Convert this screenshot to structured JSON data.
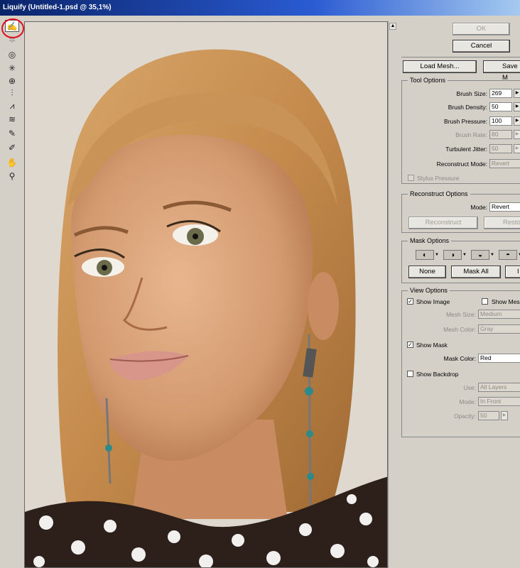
{
  "window": {
    "title": "Liquify (Untitled-1.psd @ 35,1%)"
  },
  "tools": [
    {
      "name": "forward-warp-tool",
      "icon": "finger-icon",
      "glyph": "✍",
      "active": true
    },
    {
      "name": "turbulence-tool",
      "icon": "turbulence-icon",
      "glyph": "✲",
      "dim": true
    },
    {
      "name": "twirl-tool",
      "icon": "twirl-icon",
      "glyph": "◎"
    },
    {
      "name": "pucker-tool",
      "icon": "pucker-icon",
      "glyph": "✳"
    },
    {
      "name": "bloat-tool",
      "icon": "bloat-icon",
      "glyph": "⊕"
    },
    {
      "name": "push-left-tool",
      "icon": "push-left-icon",
      "glyph": "⫶"
    },
    {
      "name": "mirror-tool",
      "icon": "mirror-icon",
      "glyph": "⩘"
    },
    {
      "name": "turbulence-wave-tool",
      "icon": "wave-icon",
      "glyph": "≋"
    },
    {
      "name": "freeze-mask-tool",
      "icon": "freeze-brush-icon",
      "glyph": "✎"
    },
    {
      "name": "thaw-mask-tool",
      "icon": "thaw-brush-icon",
      "glyph": "✐"
    },
    {
      "name": "hand-tool",
      "icon": "hand-icon",
      "glyph": "✋"
    },
    {
      "name": "zoom-tool",
      "icon": "magnifier-icon",
      "glyph": "⚲"
    }
  ],
  "buttons": {
    "ok": "OK",
    "cancel": "Cancel",
    "load_mesh": "Load Mesh...",
    "save_mesh": "Save M"
  },
  "tool_options": {
    "title": "Tool Options",
    "brush_size": {
      "label": "Brush Size:",
      "value": "269"
    },
    "brush_density": {
      "label": "Brush Density:",
      "value": "50"
    },
    "brush_pressure": {
      "label": "Brush Pressure:",
      "value": "100"
    },
    "brush_rate": {
      "label": "Brush Rate:",
      "value": "80"
    },
    "turbulent_jitter": {
      "label": "Turbulent Jitter:",
      "value": "50"
    },
    "reconstruct_mode": {
      "label": "Reconstruct Mode:",
      "value": "Revert"
    },
    "stylus_pressure": "Stylus Pressure"
  },
  "reconstruct_options": {
    "title": "Reconstruct Options",
    "mode_label": "Mode:",
    "mode_value": "Revert",
    "reconstruct_btn": "Reconstruct",
    "restore_btn": "Resto"
  },
  "mask_options": {
    "title": "Mask Options",
    "none_btn": "None",
    "mask_all_btn": "Mask All",
    "invert_btn": "I"
  },
  "view_options": {
    "title": "View Options",
    "show_image": "Show Image",
    "show_mesh": "Show Mes",
    "mesh_size": {
      "label": "Mesh Size:",
      "value": "Medium"
    },
    "mesh_color": {
      "label": "Mesh Color:",
      "value": "Gray"
    },
    "show_mask": "Show Mask",
    "mask_color": {
      "label": "Mask Color:",
      "value": "Red"
    },
    "show_backdrop": "Show Backdrop",
    "use": {
      "label": "Use:",
      "value": "All Layers"
    },
    "mode": {
      "label": "Mode:",
      "value": "In Front"
    },
    "opacity": {
      "label": "Opacity:",
      "value": "50"
    }
  },
  "colors": {
    "title_bar": "#0a246a",
    "annotation": "#e01020",
    "panel_bg": "#d4d0c8"
  }
}
